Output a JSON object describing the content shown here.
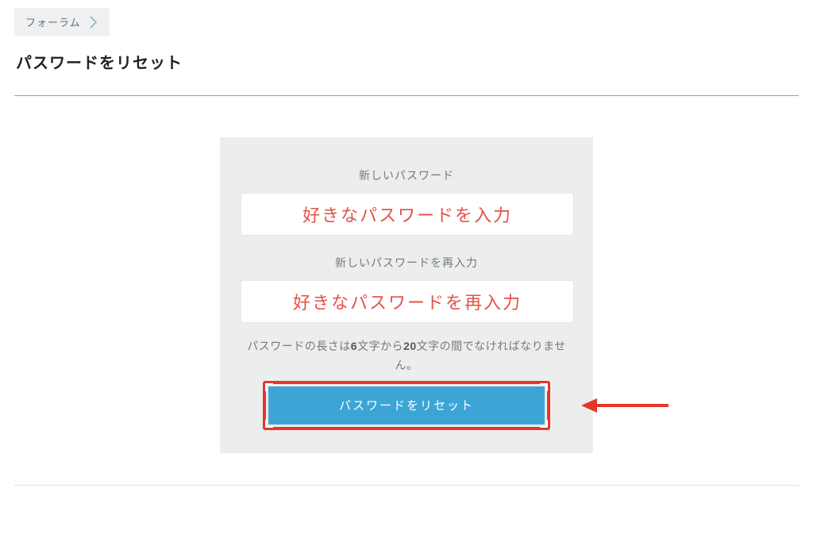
{
  "breadcrumb": {
    "label": "フォーラム"
  },
  "page": {
    "title": "パスワードをリセット"
  },
  "form": {
    "password_label": "新しいパスワード",
    "password_value": "好きなパスワードを入力",
    "confirm_label": "新しいパスワードを再入力",
    "confirm_value": "好きなパスワードを再入力",
    "help_prefix": "パスワードの長さは",
    "help_min": "6",
    "help_mid": "文字から",
    "help_max": "20",
    "help_suffix": "文字の間でなければなりません。",
    "submit_label": "パスワードをリセット"
  },
  "colors": {
    "accent": "#3ca5d6",
    "annotation": "#e4362b",
    "input_text": "#e4524a"
  }
}
